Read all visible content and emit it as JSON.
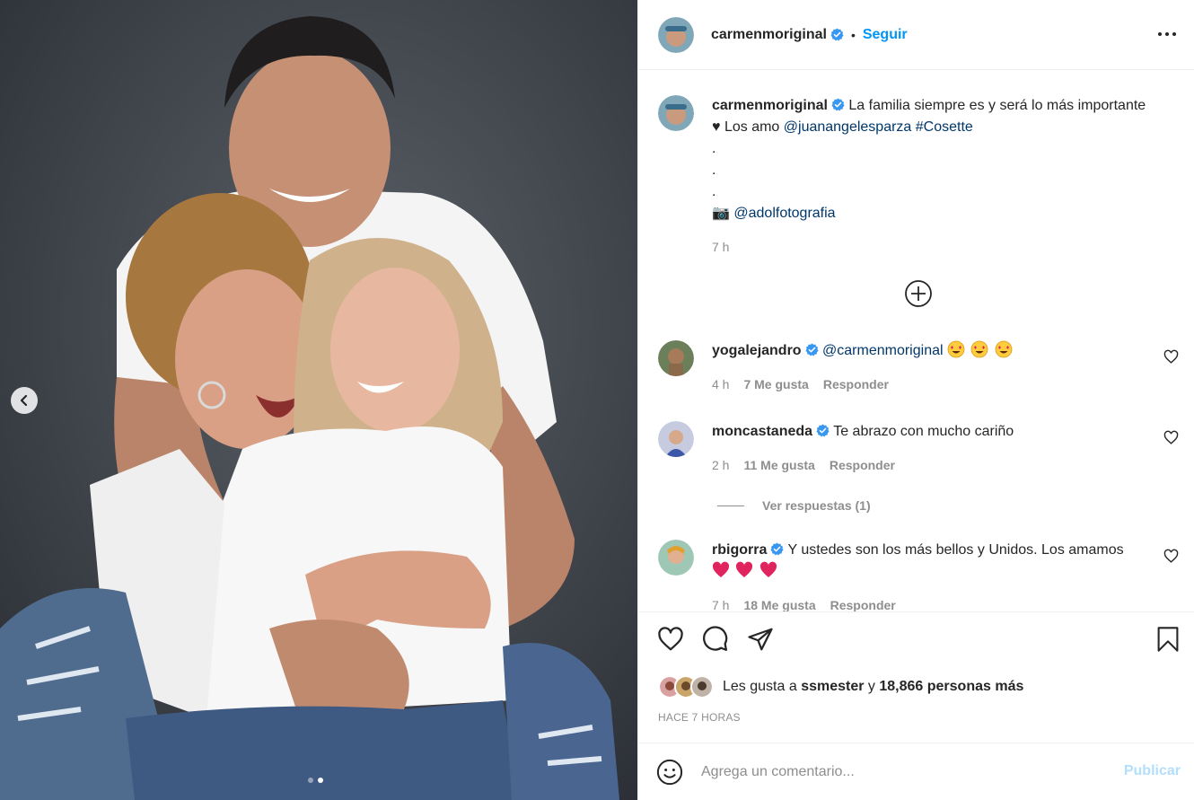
{
  "post": {
    "author": "carmenmoriginal",
    "follow_label": "Seguir",
    "separator": "•",
    "caption": {
      "text_line1": "La familia siempre es y será lo más importante",
      "text_line2_prefix": "♥ Los amo",
      "mention1": "@juanangelesparza",
      "hashtag": "#Cosette",
      "dots": [
        ".",
        ".",
        "."
      ],
      "camera_emoji": "📷",
      "mention2": "@adolfotografia",
      "time": "7 h"
    },
    "carousel": {
      "current_index": 2,
      "total": 2
    }
  },
  "comments": [
    {
      "user": "yogalejandro",
      "mention": "@carmenmoriginal",
      "text": "",
      "emoji_count": 3,
      "time": "4 h",
      "likes": "7 Me gusta",
      "reply_label": "Responder"
    },
    {
      "user": "moncastaneda",
      "text": "Te abrazo con mucho cariño",
      "time": "2 h",
      "likes": "11 Me gusta",
      "reply_label": "Responder",
      "view_replies": "Ver respuestas (1)"
    },
    {
      "user": "rbigorra",
      "text": "Y ustedes son los más bellos y Unidos. Los amamos",
      "hearts": 3,
      "time": "7 h",
      "likes": "18 Me gusta",
      "reply_label": "Responder"
    }
  ],
  "likes": {
    "prefix": "Les gusta a",
    "user": "ssmester",
    "connector": "y",
    "others": "18,866 personas más"
  },
  "timestamp": "HACE 7 HORAS",
  "composer": {
    "placeholder": "Agrega un comentario...",
    "publish_label": "Publicar"
  },
  "colors": {
    "accent": "#0095f6",
    "publish_disabled": "#b2dffc",
    "muted": "#8e8e8e",
    "link": "#00376b",
    "verified": "#3897f0"
  },
  "icons": [
    "chevron-left-icon",
    "more-options-icon",
    "verified-badge-icon",
    "add-circle-icon",
    "heart-icon",
    "comment-icon",
    "share-icon",
    "bookmark-icon",
    "smiley-icon"
  ]
}
